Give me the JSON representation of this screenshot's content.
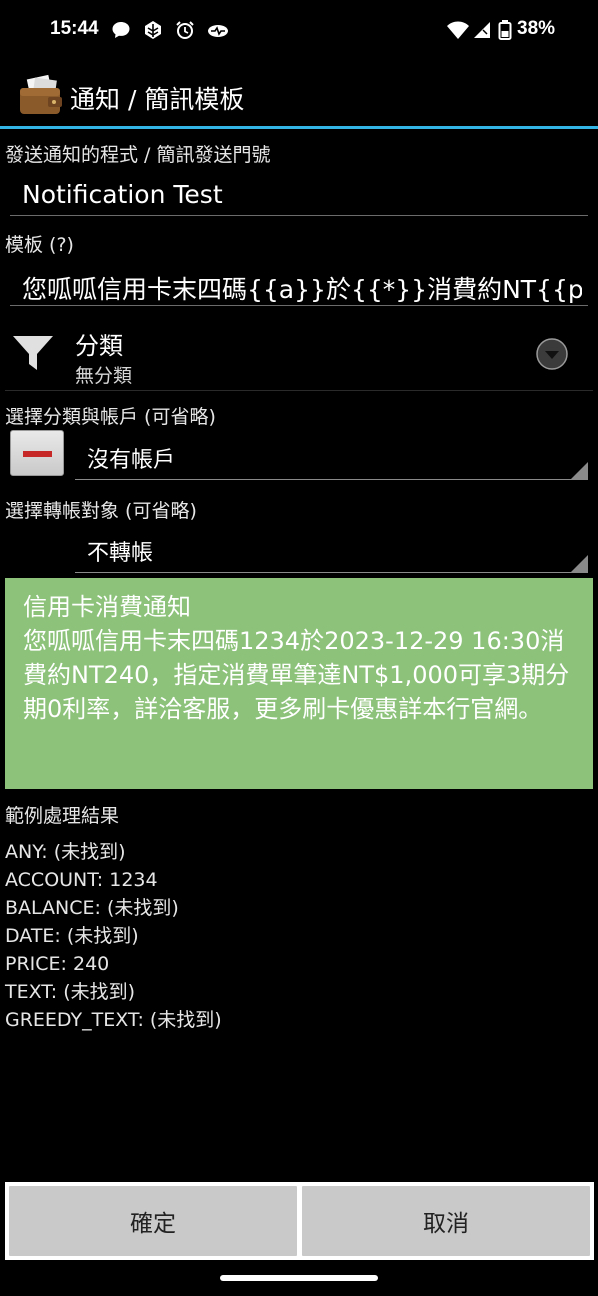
{
  "status_bar": {
    "time": "15:44",
    "battery": "38%"
  },
  "header": {
    "title": "通知 / 簡訊模板"
  },
  "form": {
    "source_label": "發送通知的程式 / 簡訊發送門號",
    "source_value": "Notification Test",
    "template_label": "模板 (?)",
    "template_value": "您呱呱信用卡末四碼{{a}}於{{*}}消費約NT{{p}}，",
    "category_label": "分類",
    "category_value": "無分類",
    "account_label": "選擇分類與帳戶 (可省略)",
    "account_value": "沒有帳戶",
    "transfer_label": "選擇轉帳對象 (可省略)",
    "transfer_value": "不轉帳"
  },
  "preview": {
    "title": "信用卡消費通知",
    "body": "您呱呱信用卡末四碼1234於2023-12-29 16:30消費約NT240，指定消費單筆達NT$1,000可享3期分期0利率，詳洽客服，更多刷卡優惠詳本行官網。"
  },
  "results": {
    "title": "範例處理結果",
    "items": [
      "ANY: (未找到)",
      "ACCOUNT: 1234",
      "BALANCE: (未找到)",
      "DATE: (未找到)",
      "PRICE: 240",
      "TEXT: (未找到)",
      "GREEDY_TEXT: (未找到)"
    ]
  },
  "buttons": {
    "confirm": "確定",
    "cancel": "取消"
  },
  "colors": {
    "accent": "#33b5e5",
    "preview_bg": "#8cc27a"
  }
}
